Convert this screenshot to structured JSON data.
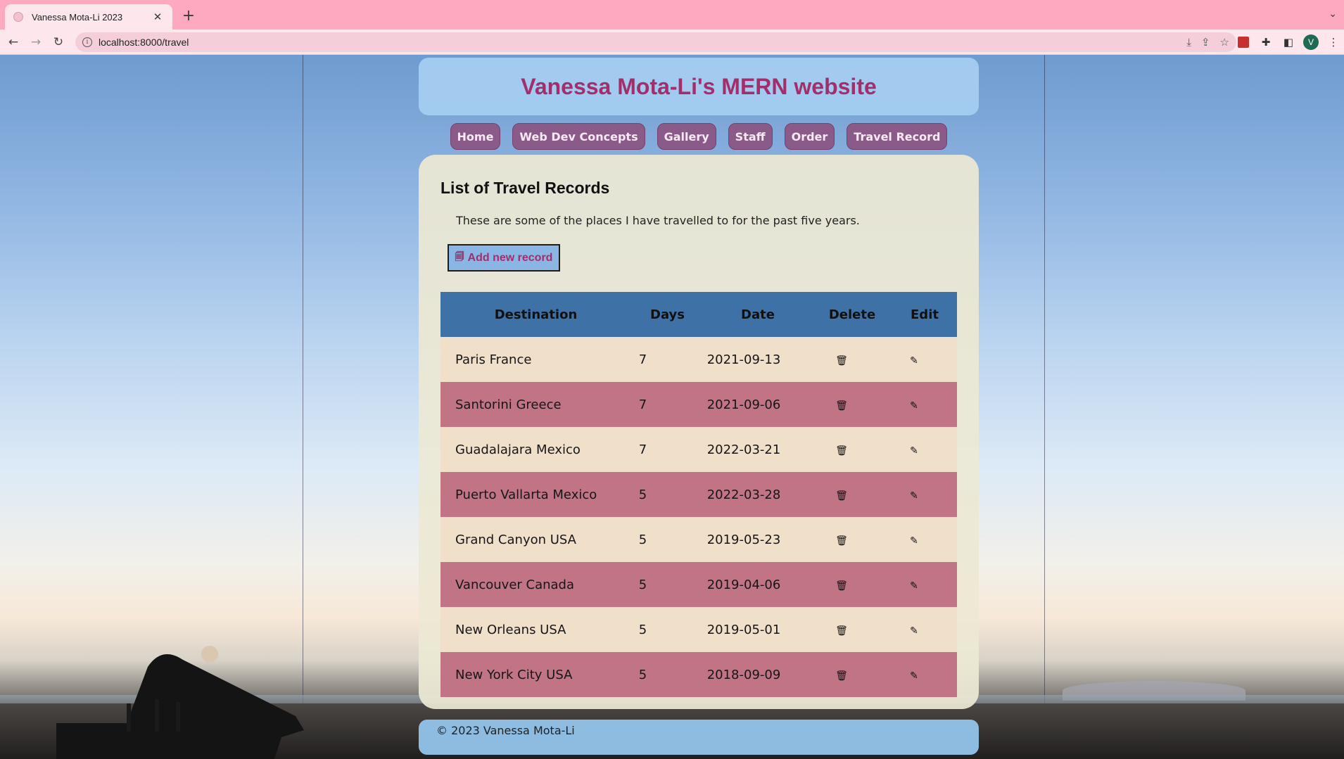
{
  "browser": {
    "tab_title": "Vanessa Mota-Li 2023",
    "tab_close": "✕",
    "new_tab": "+",
    "url": "localhost:8000/travel",
    "profile_initial": "V"
  },
  "site": {
    "title": "Vanessa Mota-Li's MERN website",
    "nav": [
      "Home",
      "Web Dev Concepts",
      "Gallery",
      "Staff",
      "Order",
      "Travel Record"
    ]
  },
  "page": {
    "heading": "List of Travel Records",
    "description": "These are some of the places I have travelled to for the past five years.",
    "add_button": "Add new record"
  },
  "table": {
    "headers": [
      "Destination",
      "Days",
      "Date",
      "Delete",
      "Edit"
    ],
    "rows": [
      {
        "destination": "Paris France",
        "days": "7",
        "date": "2021-09-13"
      },
      {
        "destination": "Santorini Greece",
        "days": "7",
        "date": "2021-09-06"
      },
      {
        "destination": "Guadalajara Mexico",
        "days": "7",
        "date": "2022-03-21"
      },
      {
        "destination": "Puerto Vallarta Mexico",
        "days": "5",
        "date": "2022-03-28"
      },
      {
        "destination": "Grand Canyon USA",
        "days": "5",
        "date": "2019-05-23"
      },
      {
        "destination": "Vancouver Canada",
        "days": "5",
        "date": "2019-04-06"
      },
      {
        "destination": "New Orleans USA",
        "days": "5",
        "date": "2019-05-01"
      },
      {
        "destination": "New York City USA",
        "days": "5",
        "date": "2018-09-09"
      }
    ],
    "delete_icon": "trash-icon",
    "edit_icon": "pencil-icon"
  },
  "footer": {
    "text": "© 2023 Vanessa Mota-Li"
  },
  "colors": {
    "title": "#a32e6b",
    "nav_bg": "#8a5a88",
    "table_header": "#3e72a6",
    "row_light": "#f0dfc9",
    "row_dark": "#c07484"
  }
}
